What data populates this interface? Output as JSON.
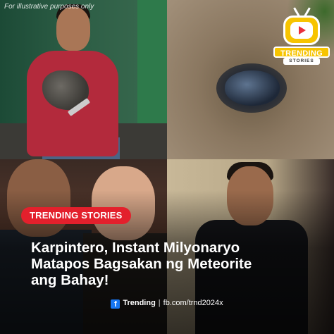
{
  "watermark": "For illustrative purposes only",
  "badge": {
    "title": "TRENDING",
    "subtitle": "STORIES",
    "icon": "tv-play-icon",
    "colors": {
      "yellow": "#f7c400",
      "red": "#e8303c"
    }
  },
  "tag": {
    "label": "TRENDING STORIES",
    "color": "#e3202c"
  },
  "headline": {
    "line1": "Karpintero, Instant Milyonaryo",
    "line2": "Matapos Bagsakan ng Meteorite",
    "line3": "ang Bahay!"
  },
  "footer": {
    "icon": "facebook-icon",
    "brand": "Trending",
    "separator": "|",
    "url": "fb.com/trnd2024x"
  }
}
